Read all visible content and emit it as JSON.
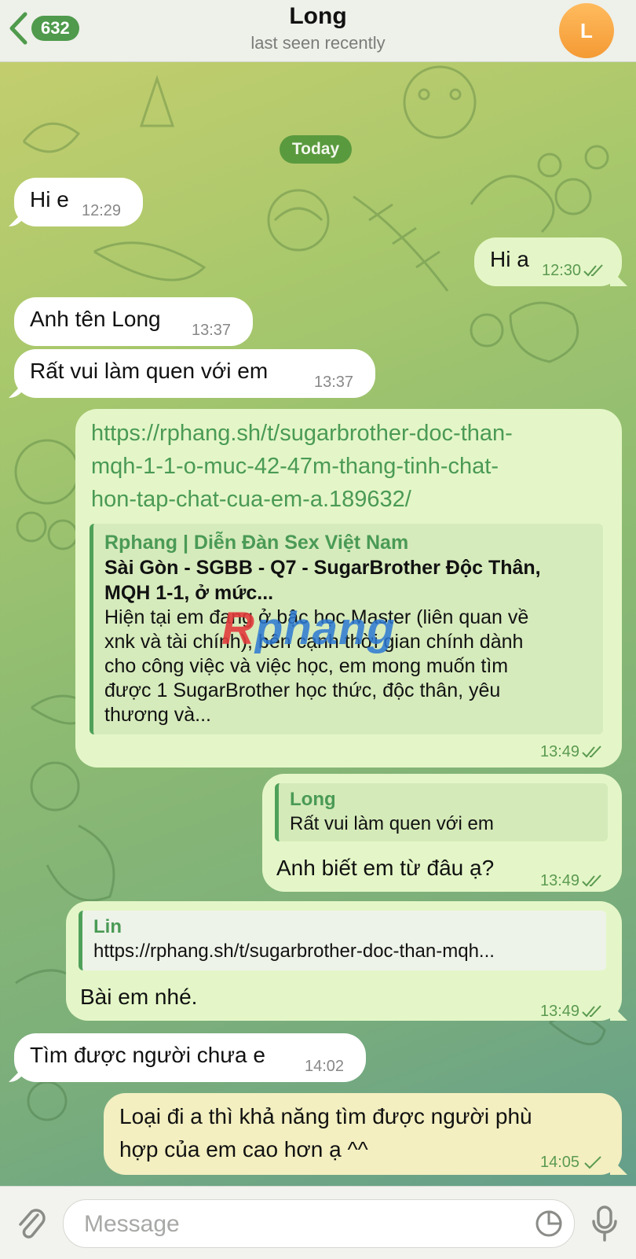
{
  "header": {
    "back_count": "632",
    "title": "Long",
    "subtitle": "last seen recently",
    "avatar_letter": "L"
  },
  "date_label": "Today",
  "messages": [
    {
      "dir": "in",
      "text": "Hi e",
      "time": "12:29"
    },
    {
      "dir": "out",
      "text": "Hi a",
      "time": "12:30",
      "status": "read"
    },
    {
      "dir": "in",
      "text": "Anh tên Long",
      "time": "13:37"
    },
    {
      "dir": "in",
      "text": "Rất vui làm quen với em",
      "time": "13:37"
    },
    {
      "dir": "out",
      "link_lines": [
        "https://rphang.sh/t/sugarbrother-doc-than-",
        "mqh-1-1-o-muc-42-47m-thang-tinh-chat-",
        "hon-tap-chat-cua-em-a.189632/"
      ],
      "preview": {
        "site": "Rphang | Diễn Đàn Sex Việt Nam",
        "title_lines": [
          "Sài Gòn - SGBB - Q7 - SugarBrother Độc Thân,",
          "MQH 1-1, ở mức..."
        ],
        "desc_lines": [
          "Hiện tại em đang ở bậc học Master (liên quan về",
          "xnk và tài chính), bên cạnh thời gian chính dành",
          "cho công việc và việc học, em mong muốn tìm",
          "được 1 SugarBrother học thức, độc thân, yêu",
          "thương và..."
        ]
      },
      "time": "13:49",
      "status": "read"
    },
    {
      "dir": "out",
      "reply_name": "Long",
      "reply_text": "Rất vui làm quen với em",
      "text": "Anh biết em từ đâu ạ?",
      "time": "13:49",
      "status": "read"
    },
    {
      "dir": "out",
      "reply_name": "Lin",
      "reply_text": "https://rphang.sh/t/sugarbrother-doc-than-mqh...",
      "text": "Bài em nhé.",
      "time": "13:49",
      "status": "read"
    },
    {
      "dir": "in",
      "text": "Tìm được người chưa e",
      "time": "14:02"
    },
    {
      "dir": "out",
      "lines": [
        "Loại đi a thì khả năng tìm được người phù",
        "hợp của em cao hơn ạ ^^"
      ],
      "time": "14:05",
      "status": "sent"
    }
  ],
  "watermark": {
    "first": "R",
    "rest": "phang"
  },
  "input": {
    "placeholder": "Message"
  },
  "icons": [
    "back-chevron-icon",
    "attach-icon",
    "sticker-icon",
    "mic-icon",
    "double-check-icon",
    "single-check-icon"
  ],
  "colors": {
    "accent": "#4f9a4c",
    "out_bubble": "#e4f6c7",
    "in_bubble": "#ffffff",
    "avatar": "#f49a34"
  }
}
